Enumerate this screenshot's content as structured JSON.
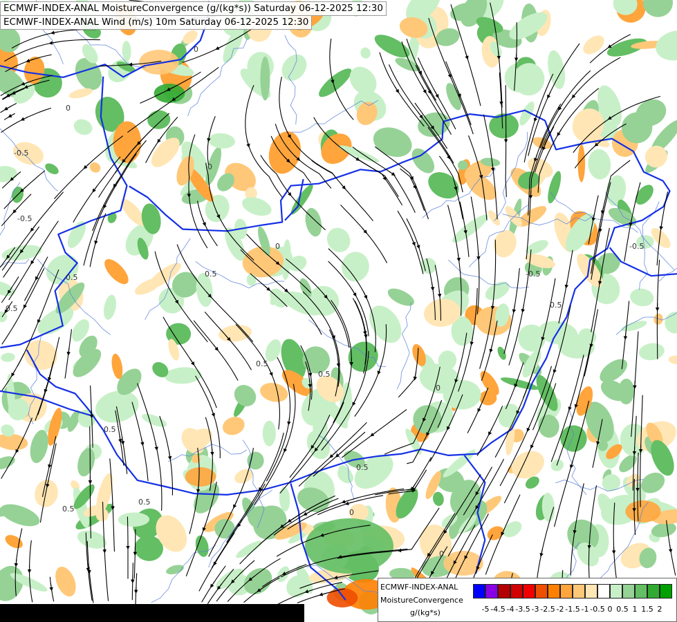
{
  "titles": [
    "ECMWF-INDEX-ANAL MoistureConvergence (g/(kg*s)) Saturday 06-12-2025 12:30",
    "ECMWF-INDEX-ANAL Wind (m/s) 10m Saturday 06-12-2025 12:30"
  ],
  "legend": {
    "model": "ECMWF-INDEX-ANAL",
    "variable": "MoistureConvergence",
    "unit": "g/(kg*s)",
    "colors": [
      "#0000ff",
      "#8a00e6",
      "#b40000",
      "#d20000",
      "#f00000",
      "#f04e00",
      "#ff8000",
      "#ffa53c",
      "#ffc878",
      "#ffe6b4",
      "#ffffff",
      "#c8f0c8",
      "#96d296",
      "#64be64",
      "#32aa32",
      "#00a000"
    ],
    "tick_labels": [
      "-5",
      "-4.5",
      "-4",
      "-3.5",
      "-3",
      "-2.5",
      "-2",
      "-1.5",
      "-1",
      "-0.5",
      "0",
      "0.5",
      "1",
      "1.5",
      "2"
    ]
  },
  "contour_labels": [
    "0",
    "0",
    "0",
    "-0.5",
    "-0.5",
    "0.5",
    "0.5",
    "0.5",
    "0",
    "0.5",
    "0.5",
    "0",
    "0.5",
    "0",
    "-0.5",
    "0.5",
    "-0.5",
    "0.5",
    "0.5",
    "0.5",
    "0"
  ]
}
